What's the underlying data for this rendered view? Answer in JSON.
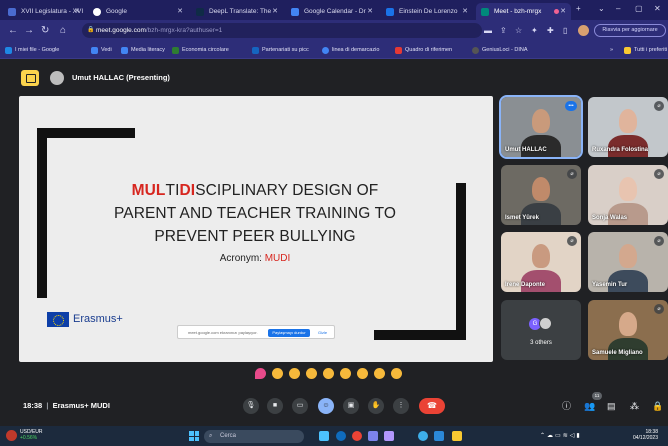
{
  "browser": {
    "tabs": [
      {
        "label": "XVII Legislatura - XVI",
        "active": false
      },
      {
        "label": "Google",
        "active": false
      },
      {
        "label": "DeepL Translate: The",
        "active": false
      },
      {
        "label": "Google Calendar - Dr",
        "active": false
      },
      {
        "label": "Einstein De Lorenzo",
        "active": false
      },
      {
        "label": "Meet - bzh-mrgx",
        "active": true
      }
    ],
    "new_tab": "+",
    "window_controls": [
      "⌄",
      "–",
      "▢",
      "✕"
    ],
    "url_host": "meet.google.com",
    "url_path": "/bzh-mrgx-kra?authuser=1",
    "update_label": "Riavvia per aggiornare",
    "bookmarks": [
      {
        "label": "I miei file - Google",
        "color": "#1e88e5"
      },
      {
        "label": "Vedi",
        "color": "#4285f4"
      },
      {
        "label": "Media literacy",
        "color": "#4285f4"
      },
      {
        "label": "Economia circolare",
        "color": "#2e7d32"
      },
      {
        "label": "Partenariati su picc",
        "color": "#1565c0"
      },
      {
        "label": "linea di demarcazio",
        "color": "#4285f4"
      },
      {
        "label": "Quadro di riferimen",
        "color": "#e53935"
      },
      {
        "label": "GeniusLoci - DINA",
        "color": "#555"
      }
    ],
    "all_bookmarks": "Tutti i preferiti"
  },
  "meet": {
    "presenter": "Umut HALLAC (Presenting)",
    "slide": {
      "title_line1_red1": "MUL",
      "title_line1_black1": "TI",
      "title_line1_red2": "DI",
      "title_line1_black2": "SCIPLINARY DESIGN OF",
      "title_line2": "PARENT AND TEACHER TRAINING TO",
      "title_line3": "PREVENT PEER BULLYING",
      "acronym_label": "Acronym: ",
      "acronym_value": "MUDI",
      "erasmus": "Erasmus+",
      "share_text": "meet.google.com ekranınızı paylaşıyor.",
      "share_stop": "Paylaşmayı durdur",
      "share_hide": "Gizle"
    },
    "participants": [
      {
        "name": "Umut HALLAC",
        "bg": "#8a8f93",
        "skin": "#c99a7b",
        "shirt": "#2b2b2b"
      },
      {
        "name": "Ruxandra Folostina",
        "bg": "#c2c7cb",
        "skin": "#e0b49c",
        "shirt": "#7a2c2c"
      },
      {
        "name": "Ismet Yürek",
        "bg": "#6d6a63",
        "skin": "#c08a6a",
        "shirt": "#3a3f44"
      },
      {
        "name": "Sonja Walas",
        "bg": "#d9cfc8",
        "skin": "#e8c4b0",
        "shirt": "#b89a8c"
      },
      {
        "name": "Irene Daponte",
        "bg": "#e2d4c6",
        "skin": "#c99a80",
        "shirt": "#a34f6e"
      },
      {
        "name": "Yasemin Tur",
        "bg": "#b8b3ab",
        "skin": "#d3a88e",
        "shirt": "#3d4b5c"
      },
      {
        "name": "Samuele Migliano",
        "bg": "#8b6e4e",
        "skin": "#d6a98a",
        "shirt": "#2f3d2f"
      }
    ],
    "others_label": "3 others",
    "others_initial": "G",
    "time": "18:38",
    "meeting_name": "Erasmus+ MUDI",
    "participant_count": "11",
    "reactions": [
      "#e84a8a",
      "#f6b93b",
      "#f6b93b",
      "#f6b93b",
      "#f6b93b",
      "#f6b93b",
      "#f6b93b",
      "#f6b93b",
      "#f6b93b"
    ]
  },
  "taskbar": {
    "ticker_name": "USD/EUR",
    "ticker_change": "+0.56%",
    "search_placeholder": "Cerca",
    "clock_time": "18:38",
    "clock_date": "04/12/2023"
  },
  "colors": {
    "red_accent": "#d7261f",
    "meet_bg": "#202124",
    "browser": "#2d2d78"
  }
}
